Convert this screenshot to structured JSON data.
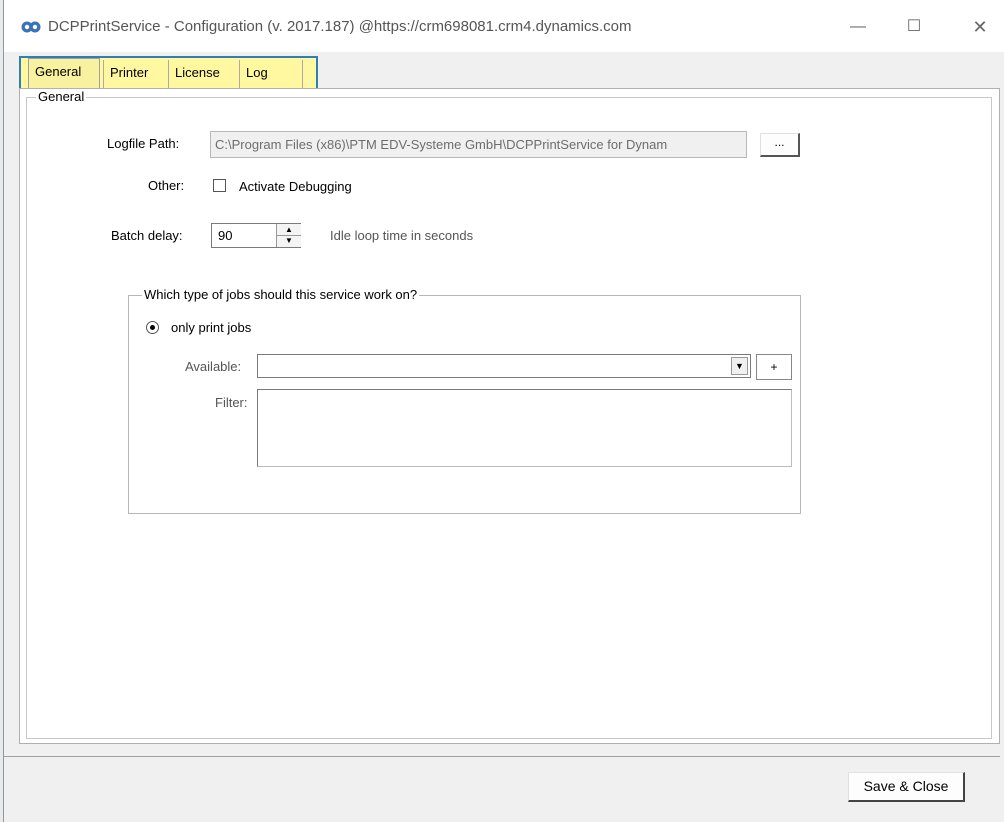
{
  "window": {
    "title": "DCPPrintService - Configuration  (v. 2017.187) @https://crm698081.crm4.dynamics.com",
    "minimize_glyph": "—",
    "maximize_glyph": "☐",
    "close_glyph": "✕"
  },
  "tabs": [
    {
      "label": "General",
      "active": true
    },
    {
      "label": "Printer"
    },
    {
      "label": "License"
    },
    {
      "label": "Log"
    }
  ],
  "general": {
    "group_title": "General",
    "logfile_label": "Logfile Path:",
    "logfile_value": "C:\\Program Files (x86)\\PTM EDV-Systeme GmbH\\DCPPrintService for Dynam",
    "browse_label": "...",
    "other_label": "Other:",
    "debug_label": "Activate Debugging",
    "debug_checked": false,
    "batch_label": "Batch delay:",
    "batch_value": "90",
    "batch_hint": "Idle loop time in seconds"
  },
  "jobs": {
    "group_title": "Which type of jobs should this service work on?",
    "option_label": "only print jobs",
    "available_label": "Available:",
    "available_value": "",
    "add_label": "+",
    "filter_label": "Filter:",
    "filter_value": ""
  },
  "footer": {
    "save_label": "Save & Close"
  },
  "colors": {
    "tab_highlight": "#fff8a0",
    "tab_highlight_border": "#2f7fb5"
  }
}
